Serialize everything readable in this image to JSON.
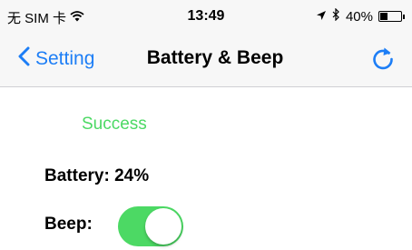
{
  "status_bar": {
    "carrier": "无 SIM 卡",
    "wifi_icon": "wifi-icon",
    "time": "13:49",
    "location_icon": "location-arrow-icon",
    "bluetooth_icon": "bluetooth-icon",
    "battery_percent": "40%",
    "battery_level": 0.4
  },
  "nav": {
    "back_label": "Setting",
    "title": "Battery & Beep",
    "refresh_icon": "refresh-icon",
    "accent_color": "#1d7ef6"
  },
  "content": {
    "status_message": "Success",
    "status_color": "#4cd964",
    "battery_text": "Battery: 24%",
    "beep_label": "Beep:",
    "beep_on": true,
    "toggle_color": "#4cd964"
  }
}
